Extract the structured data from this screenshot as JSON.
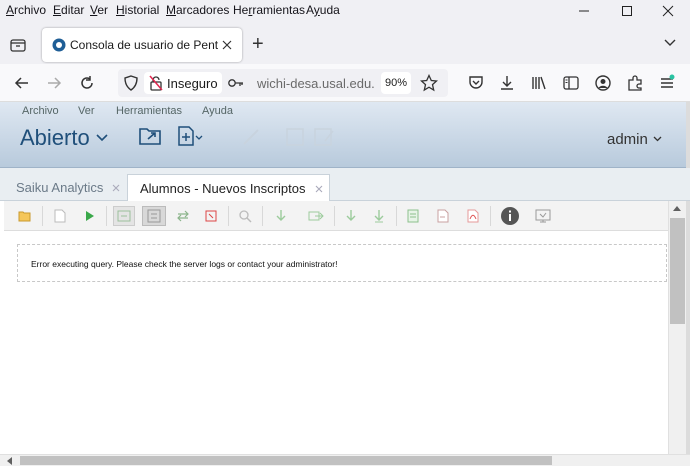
{
  "menubar": {
    "items": [
      "Archivo",
      "Editar",
      "Ver",
      "Historial",
      "Marcadores",
      "Herramientas",
      "Ayuda"
    ],
    "accel": [
      "A",
      "E",
      "V",
      "H",
      "M",
      "r",
      "y"
    ]
  },
  "browser_tab": {
    "title": "Consola de usuario de Pentaho",
    "new_tab": "+"
  },
  "navbar": {
    "security_label": "Inseguro",
    "url": "wichi-desa.usal.edu.ar",
    "zoom": "90%"
  },
  "pentaho": {
    "menu": [
      "Archivo",
      "Ver",
      "Herramientas",
      "Ayuda"
    ],
    "perspective": "Abierto",
    "user": "admin"
  },
  "doc_tabs": [
    {
      "label": "Saiku Analytics",
      "active": false
    },
    {
      "label": "Alumnos - Nuevos Inscriptos",
      "active": true
    }
  ],
  "error_message": "Error executing query. Please check the server logs or contact your administrator!",
  "colors": {
    "header_top": "#dfe8f2",
    "header_bottom": "#b8cadc",
    "accent": "#1f4f7a"
  },
  "toolbar_icons": [
    "open-query-icon",
    "new-query-icon",
    "run-query-icon",
    "automatic-execution-icon",
    "toggle-fields-icon",
    "swap-axes-icon",
    "non-empty-icon",
    "zoom-mode-icon",
    "drillthrough-icon",
    "export-drillthrough-icon",
    "drill-down-icon",
    "drill-across-icon",
    "export-xls-icon",
    "export-csv-icon",
    "export-pdf-icon",
    "info-icon",
    "switch-render-icon"
  ]
}
